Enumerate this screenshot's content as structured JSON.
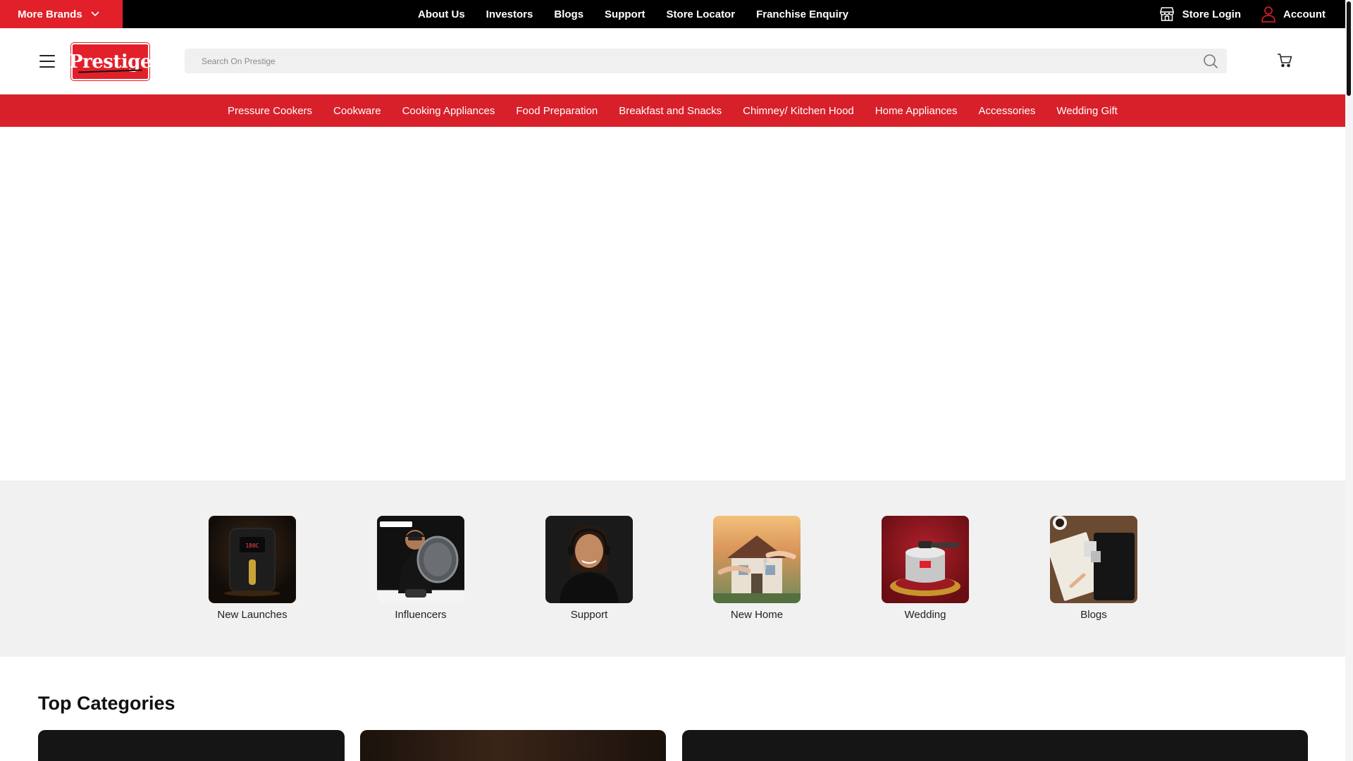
{
  "topbar": {
    "more_brands_label": "More Brands",
    "links": [
      "About Us",
      "Investors",
      "Blogs",
      "Support",
      "Store Locator",
      "Franchise Enquiry"
    ],
    "store_login_label": "Store Login",
    "account_label": "Account"
  },
  "header": {
    "logo_text": "Prestige",
    "search_placeholder": "Search On Prestige"
  },
  "category_nav": {
    "items": [
      "Pressure Cookers",
      "Cookware",
      "Cooking Appliances",
      "Food Preparation",
      "Breakfast and Snacks",
      "Chimney/ Kitchen Hood",
      "Home Appliances",
      "Accessories",
      "Wedding Gift"
    ]
  },
  "quick_links": {
    "items": [
      {
        "label": "New Launches",
        "image": "air-fryer-image"
      },
      {
        "label": "Influencers",
        "image": "influencer-with-pan-image"
      },
      {
        "label": "Support",
        "image": "support-agent-image"
      },
      {
        "label": "New Home",
        "image": "house-keys-image"
      },
      {
        "label": "Wedding",
        "image": "pressure-cooker-gift-image"
      },
      {
        "label": "Blogs",
        "image": "desk-notebook-image"
      }
    ]
  },
  "top_categories": {
    "title": "Top Categories"
  },
  "colors": {
    "brand_red": "#e2202a",
    "nav_red": "#d8202a",
    "topbar_black": "#000000",
    "quick_bg": "#f1f1f1"
  }
}
